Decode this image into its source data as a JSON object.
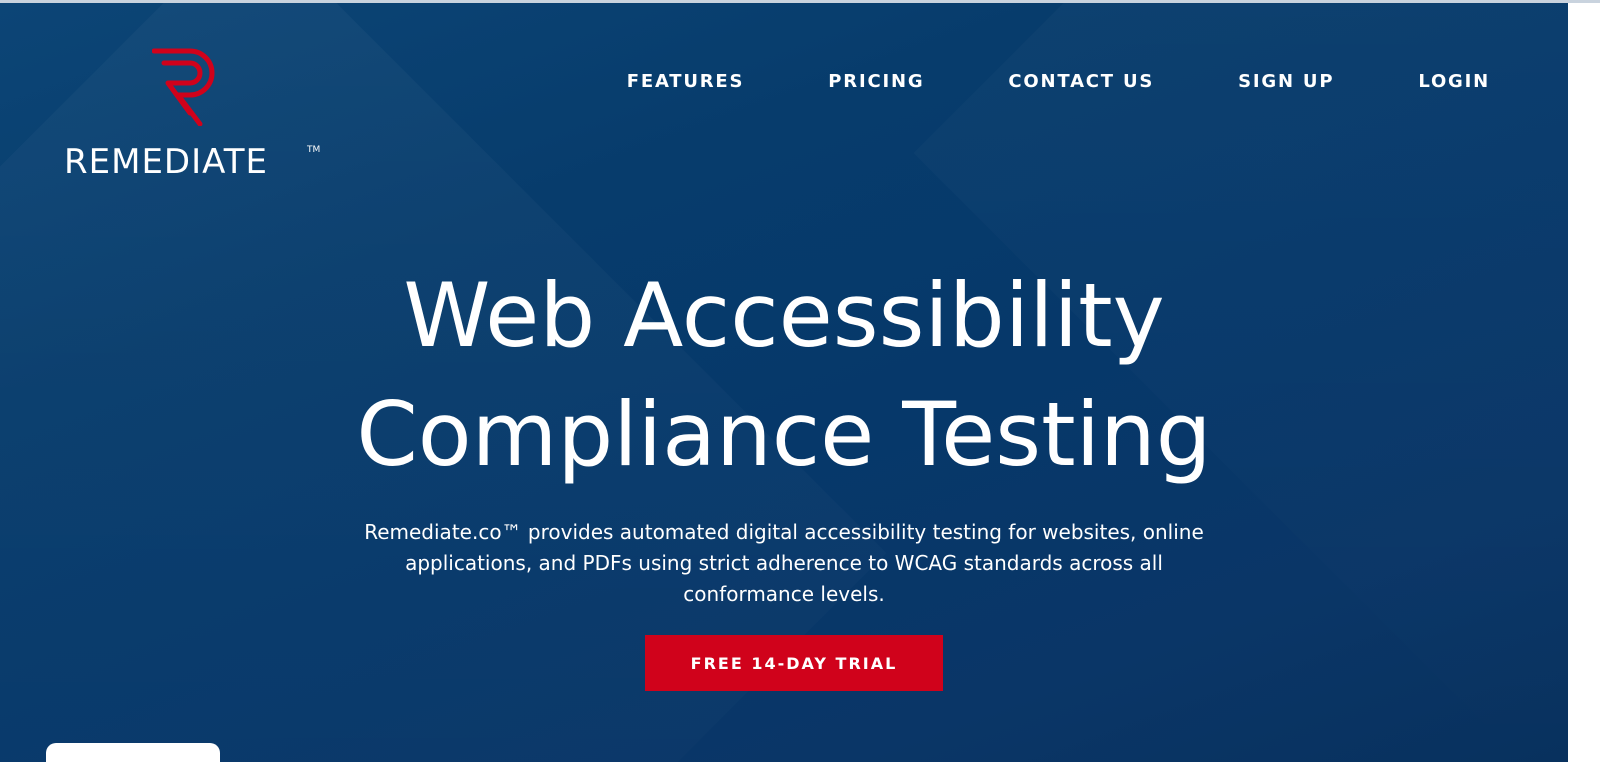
{
  "brand": {
    "name": "REMEDIATE",
    "trademark": "TM",
    "logo_color": "#d0021b"
  },
  "nav": {
    "items": [
      {
        "label": "FEATURES"
      },
      {
        "label": "PRICING"
      },
      {
        "label": "CONTACT US"
      },
      {
        "label": "SIGN UP"
      },
      {
        "label": "LOGIN"
      }
    ]
  },
  "hero": {
    "title_line1": "Web Accessibility",
    "title_line2": "Compliance Testing",
    "description": "Remediate.co™ provides automated digital accessibility testing for websites, online applications, and PDFs using strict adherence to WCAG standards across all conformance levels.",
    "cta_label": "FREE 14-DAY TRIAL",
    "background_color": "#073c6c",
    "cta_color": "#d0021b"
  }
}
